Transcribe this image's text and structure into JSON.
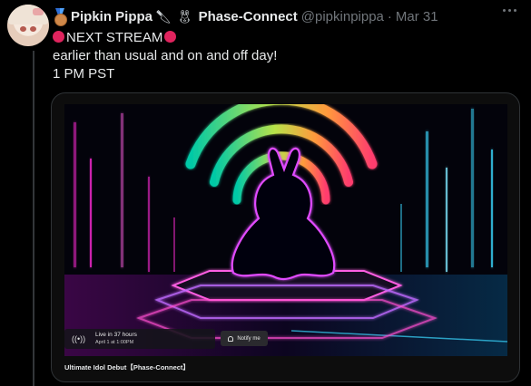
{
  "tweet": {
    "display_name": "Pipkin Pippa",
    "affiliation": "Phase-Connect",
    "handle": "@pipkinpippa",
    "separator": "·",
    "date": "Mar 31",
    "lines": [
      "NEXT STREAM",
      "earlier than usual and on and off day!",
      "1 PM PST"
    ]
  },
  "icons": {
    "medal": "sports-medal-icon",
    "knife": "knife-icon",
    "rabbit": "rabbit-face-icon",
    "red_circle": "red-circle-icon",
    "more": "more-horizontal-icon",
    "broadcast": "broadcast-icon",
    "bell": "bell-icon"
  },
  "card": {
    "live_title": "Live in 37 hours",
    "live_date": "April 1 at 1:00PM",
    "notify_label": "Notify me",
    "caption": "Ultimate Idol Debut【Phase-Connect】"
  },
  "colors": {
    "background": "#000000",
    "text": "#e7e9ea",
    "muted": "#71767b",
    "red_circle": "#e0245e",
    "neon_pink": "#ff2bd6",
    "neon_blue": "#3ad8ff"
  }
}
